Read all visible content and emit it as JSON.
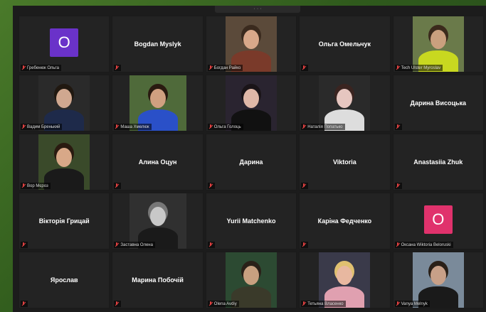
{
  "meeting": {
    "topbar_text": "· · ·",
    "colors": {
      "mic_muted": "#e04040",
      "tile_bg": "#232323"
    }
  },
  "participants": [
    {
      "name": "Гребенюк Ольга",
      "type": "letter",
      "letter": "O",
      "color": "#6a32c9",
      "muted": true
    },
    {
      "name": "Bogdan Myslyk",
      "type": "name",
      "muted": true
    },
    {
      "name": "Богдан Райко",
      "type": "video",
      "muted": true,
      "bg": "#5b4a3a",
      "skin": "#d8a88a",
      "shirt": "#7a3a2a",
      "hair": "#3a2a1e"
    },
    {
      "name": "Ольга Омельчук",
      "type": "name",
      "muted": true
    },
    {
      "name": "Tech Ulster Myroslav",
      "type": "video",
      "muted": true,
      "bg": "#6a7a4a",
      "skin": "#caa07e",
      "shirt": "#c8d820",
      "hair": "#3b2a1c"
    },
    {
      "name": "Вадим Бренький",
      "type": "video",
      "muted": true,
      "bg": "#2a2a2a",
      "skin": "#d0a890",
      "shirt": "#1e2a4a",
      "hair": "#201810"
    },
    {
      "name": "Маша Хмелюк",
      "type": "video",
      "muted": true,
      "bg": "#4f6a3a",
      "skin": "#d0a080",
      "shirt": "#2a50c8",
      "hair": "#2a1a10"
    },
    {
      "name": "Ольга Голоць",
      "type": "video",
      "muted": true,
      "bg": "#2a2430",
      "skin": "#e0b8a8",
      "shirt": "#111111",
      "hair": "#1a1418"
    },
    {
      "name": "Наталія Попатько",
      "type": "video",
      "muted": true,
      "bg": "#2a2a2a",
      "skin": "#e6c6c0",
      "shirt": "#dddddd",
      "hair": "#3a2420"
    },
    {
      "name": "Дарина Висоцька",
      "type": "name",
      "muted": true
    },
    {
      "name": "Вор Мєроз",
      "type": "video",
      "muted": true,
      "bg": "#3a4a2a",
      "skin": "#d8a888",
      "shirt": "#1a1a1a",
      "hair": "#2a1a10"
    },
    {
      "name": "Алина Оцун",
      "type": "name",
      "muted": true
    },
    {
      "name": "Дарина",
      "type": "name",
      "muted": true
    },
    {
      "name": "Viktoria",
      "type": "name",
      "muted": true
    },
    {
      "name": "Anastasiia Zhuk",
      "type": "name",
      "muted": true
    },
    {
      "name": "Вікторія Грицай",
      "type": "name",
      "muted": true
    },
    {
      "name": "Заставна Олена",
      "type": "video",
      "muted": true,
      "bg": "#303030",
      "skin": "#c8c8c8",
      "shirt": "#1a1a1a",
      "hair": "#777777"
    },
    {
      "name": "Yurii Matchenko",
      "type": "name",
      "muted": true
    },
    {
      "name": "Каріна Федченко",
      "type": "name",
      "muted": true
    },
    {
      "name": "Оксана Wiktoria Beloruski",
      "type": "letter",
      "letter": "O",
      "color": "#e0326c",
      "muted": true
    },
    {
      "name": "Ярослав",
      "type": "name",
      "muted": true
    },
    {
      "name": "Марина Побочій",
      "type": "name",
      "muted": true
    },
    {
      "name": "Olena Avdiy",
      "type": "video",
      "muted": true,
      "bg": "#2c4a32",
      "skin": "#c8a080",
      "shirt": "#3a3a2a",
      "hair": "#2a2018"
    },
    {
      "name": "Тетьяна Власенко",
      "type": "video",
      "muted": true,
      "bg": "#3a3a4a",
      "skin": "#e8b8a0",
      "shirt": "#e0a0b0",
      "hair": "#e0c070"
    },
    {
      "name": "Vanya Melnyk",
      "type": "video",
      "muted": true,
      "bg": "#7a8a9a",
      "skin": "#c8a088",
      "shirt": "#1a1a1a",
      "hair": "#2a2018"
    }
  ]
}
